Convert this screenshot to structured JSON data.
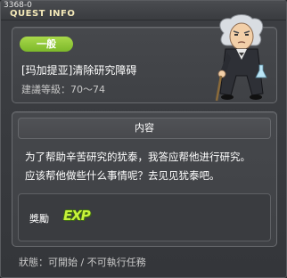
{
  "window": {
    "quest_id": "3368-0",
    "title": "QUEST INFO"
  },
  "quest": {
    "category_badge": "一般",
    "name": "[玛加提亚]清除研究障碍",
    "level_range": "建議等級：70～74"
  },
  "content": {
    "header": "内容",
    "description_line1": "为了帮助辛苦研究的犹泰，我答应帮他进行研究。",
    "description_line2": "应该帮他做些什么事情呢？去见见犹泰吧。"
  },
  "reward": {
    "label": "獎勵",
    "exp_icon_text": "EXP"
  },
  "status": {
    "text": "狀態：可開始 / 不可執行任務"
  },
  "colors": {
    "badge_green": "#8cc63a",
    "title_text": "#f4e9b8",
    "exp_green": "#c6f23a"
  }
}
